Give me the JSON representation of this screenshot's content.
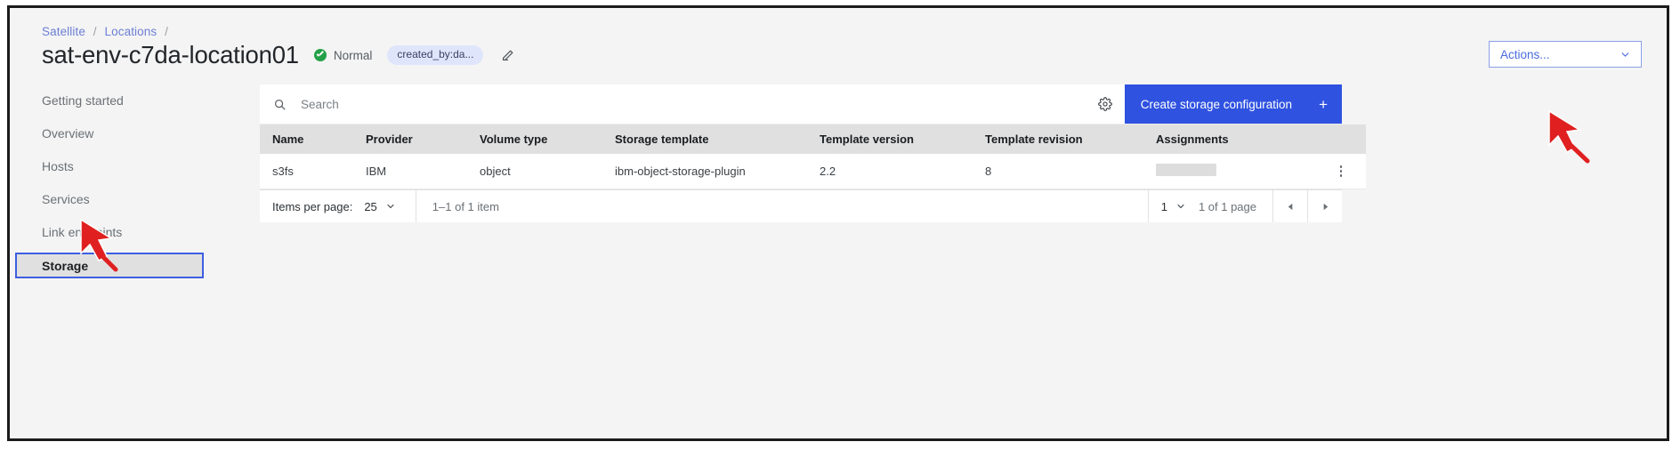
{
  "header": {
    "breadcrumb": [
      {
        "label": "Satellite",
        "sep": "/"
      },
      {
        "label": "Locations",
        "sep": "/"
      }
    ],
    "title": "sat-env-c7da-location01",
    "status_label": "Normal",
    "status_color": "#24a148",
    "tag_label": "created_by:da...",
    "edit_icon": "pencil-icon",
    "actions_label": "Actions...",
    "actions_chevron_icon": "chevron-down-icon",
    "accent_color": "#2f52e0"
  },
  "sidebar": {
    "items": [
      {
        "label": "Getting started",
        "selected": false
      },
      {
        "label": "Overview",
        "selected": false
      },
      {
        "label": "Hosts",
        "selected": false
      },
      {
        "label": "Services",
        "selected": false
      },
      {
        "label": "Link endpoints",
        "selected": false
      },
      {
        "label": "Storage",
        "selected": true
      }
    ]
  },
  "toolbar": {
    "search_placeholder": "Search",
    "search_value": "",
    "search_icon": "search-icon",
    "settings_icon": "gear-icon",
    "create_button_label": "Create storage configuration",
    "create_button_plus": "+",
    "create_button_color": "#2f52e0"
  },
  "table": {
    "columns": [
      "Name",
      "Provider",
      "Volume type",
      "Storage template",
      "Template version",
      "Template revision",
      "Assignments",
      ""
    ],
    "rows": [
      {
        "name": "s3fs",
        "provider": "IBM",
        "volume_type": "object",
        "storage_template": "ibm-object-storage-plugin",
        "template_version": "2.2",
        "template_revision": "8",
        "assignments": "",
        "assignments_loading": true,
        "overflow_icon": "overflow-menu-icon"
      }
    ]
  },
  "pagination": {
    "items_per_page_label": "Items per page:",
    "items_per_page_value": "25",
    "range_text": "1–1 of 1 item",
    "page_value": "1",
    "page_total_text": "1 of 1 page",
    "prev_icon": "caret-left-icon",
    "next_icon": "caret-right-icon",
    "chevron_icon": "chevron-down-icon"
  },
  "annotations": {
    "arrow_color": "#e02020",
    "pointer_storage": "red-arrow-pointing-to-storage-nav",
    "pointer_create": "red-arrow-pointing-to-create-button"
  }
}
